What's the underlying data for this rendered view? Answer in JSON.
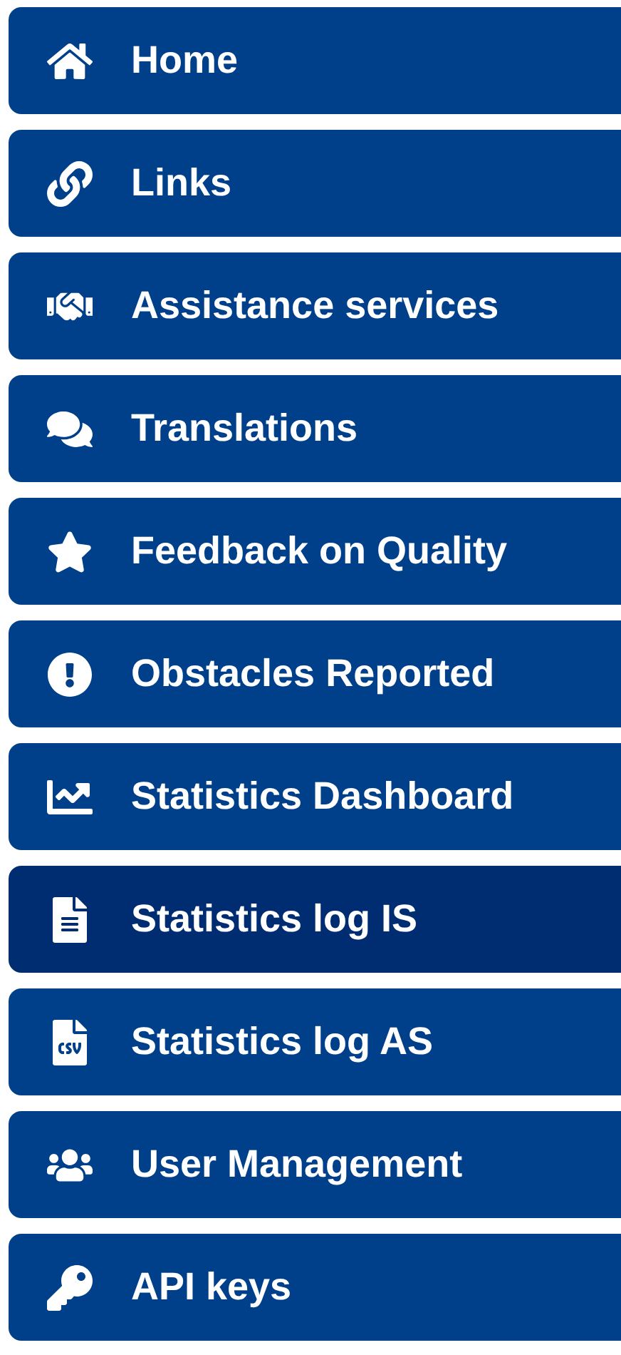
{
  "menu": [
    {
      "label": "Home",
      "selected": false
    },
    {
      "label": "Links",
      "selected": false
    },
    {
      "label": "Assistance services",
      "selected": false
    },
    {
      "label": "Translations",
      "selected": false
    },
    {
      "label": "Feedback on Quality",
      "selected": false
    },
    {
      "label": "Obstacles Reported",
      "selected": false
    },
    {
      "label": "Statistics Dashboard",
      "selected": false
    },
    {
      "label": "Statistics log IS",
      "selected": true
    },
    {
      "label": "Statistics log AS",
      "selected": false
    },
    {
      "label": "User Management",
      "selected": false
    },
    {
      "label": "API keys",
      "selected": false
    }
  ]
}
